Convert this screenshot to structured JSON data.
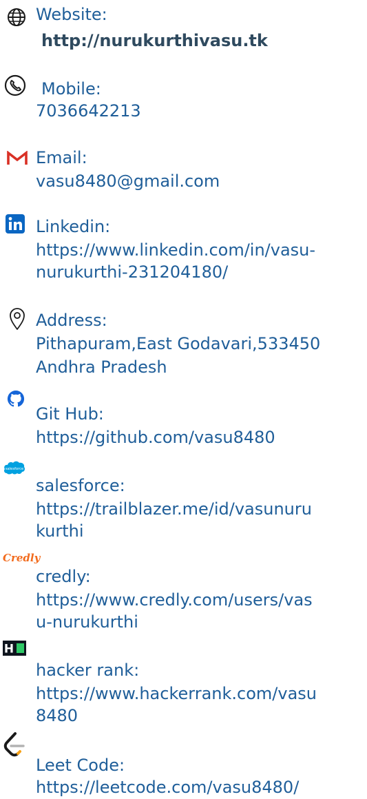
{
  "contacts": [
    {
      "label": "Website:",
      "value": "http://nurukurthivasu.tk",
      "icon": "globe-icon"
    },
    {
      "label": "Mobile:",
      "value": "7036642213",
      "icon": "phone-icon"
    },
    {
      "label": "Email:",
      "value": "vasu8480@gmail.com",
      "icon": "gmail-icon"
    },
    {
      "label": "Linkedin:",
      "value_line1": "https://www.linkedin.com/in/vasu-",
      "value_line2": "nurukurthi-231204180/",
      "icon": "linkedin-icon"
    },
    {
      "label": "Address:",
      "value_line1": "Pithapuram,East Godavari,533450",
      "value_line2": "Andhra Pradesh",
      "icon": "location-pin-icon"
    },
    {
      "label": "Git Hub:",
      "value": "https://github.com/vasu8480",
      "icon": "github-icon"
    },
    {
      "label": "salesforce:",
      "value_line1": "https://trailblazer.me/id/vasunuru",
      "value_line2": "kurthi",
      "icon": "salesforce-icon",
      "icon_text": "salesforce"
    },
    {
      "label": "credly:",
      "value_line1": "https://www.credly.com/users/vas",
      "value_line2": "u-nurukurthi",
      "icon": "credly-icon",
      "icon_text": "Credly"
    },
    {
      "label": "hacker rank:",
      "value_line1": "https://www.hackerrank.com/vasu",
      "value_line2": "8480",
      "icon": "hackerrank-icon",
      "icon_text": "H"
    },
    {
      "label": "Leet Code:",
      "value": "https://leetcode.com/vasu8480/",
      "icon": "leetcode-icon"
    }
  ],
  "colors": {
    "text": "#1f5e99",
    "bold_text": "#2f4a5f",
    "gmail_red": "#d93025",
    "linkedin_blue": "#0a66c2",
    "github_blue": "#1565d8",
    "salesforce_blue": "#00a1e0",
    "credly_orange": "#f26b1d",
    "hackerrank_green": "#2ec866",
    "leetcode_orange": "#f6a117"
  }
}
